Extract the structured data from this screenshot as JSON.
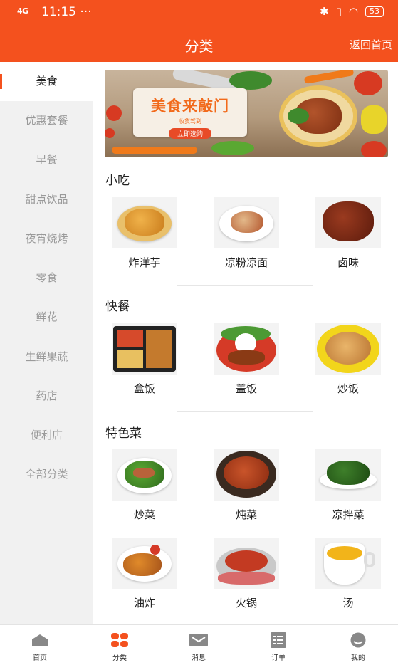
{
  "status_bar": {
    "signal": "4G",
    "time": "11:15 ···",
    "battery": "53"
  },
  "header": {
    "title": "分类",
    "back_home": "返回首页"
  },
  "sidebar": {
    "items": [
      {
        "label": "美食",
        "active": true
      },
      {
        "label": "优惠套餐"
      },
      {
        "label": "早餐"
      },
      {
        "label": "甜点饮品"
      },
      {
        "label": "夜宵烧烤"
      },
      {
        "label": "零食"
      },
      {
        "label": "鲜花"
      },
      {
        "label": "生鲜果蔬"
      },
      {
        "label": "药店"
      },
      {
        "label": "便利店"
      },
      {
        "label": "全部分类"
      }
    ]
  },
  "banner": {
    "title": "美食来敲门",
    "subtitle": "收货驾到",
    "button": "立即选购"
  },
  "sections": [
    {
      "title": "小吃",
      "items": [
        {
          "label": "炸洋芋"
        },
        {
          "label": "凉粉凉面"
        },
        {
          "label": "卤味"
        }
      ]
    },
    {
      "title": "快餐",
      "items": [
        {
          "label": "盒饭"
        },
        {
          "label": "盖饭"
        },
        {
          "label": "炒饭"
        }
      ]
    },
    {
      "title": "特色菜",
      "items": [
        {
          "label": "炒菜"
        },
        {
          "label": "炖菜"
        },
        {
          "label": "凉拌菜"
        },
        {
          "label": "油炸"
        },
        {
          "label": "火锅"
        },
        {
          "label": "汤"
        }
      ]
    }
  ],
  "tabbar": {
    "items": [
      {
        "label": "首页"
      },
      {
        "label": "分类",
        "active": true
      },
      {
        "label": "消息"
      },
      {
        "label": "订单"
      },
      {
        "label": "我的"
      }
    ]
  },
  "colors": {
    "accent": "#f4511e",
    "sidebar_bg": "#f1f1f1",
    "inactive_text": "#9a9a9a"
  }
}
